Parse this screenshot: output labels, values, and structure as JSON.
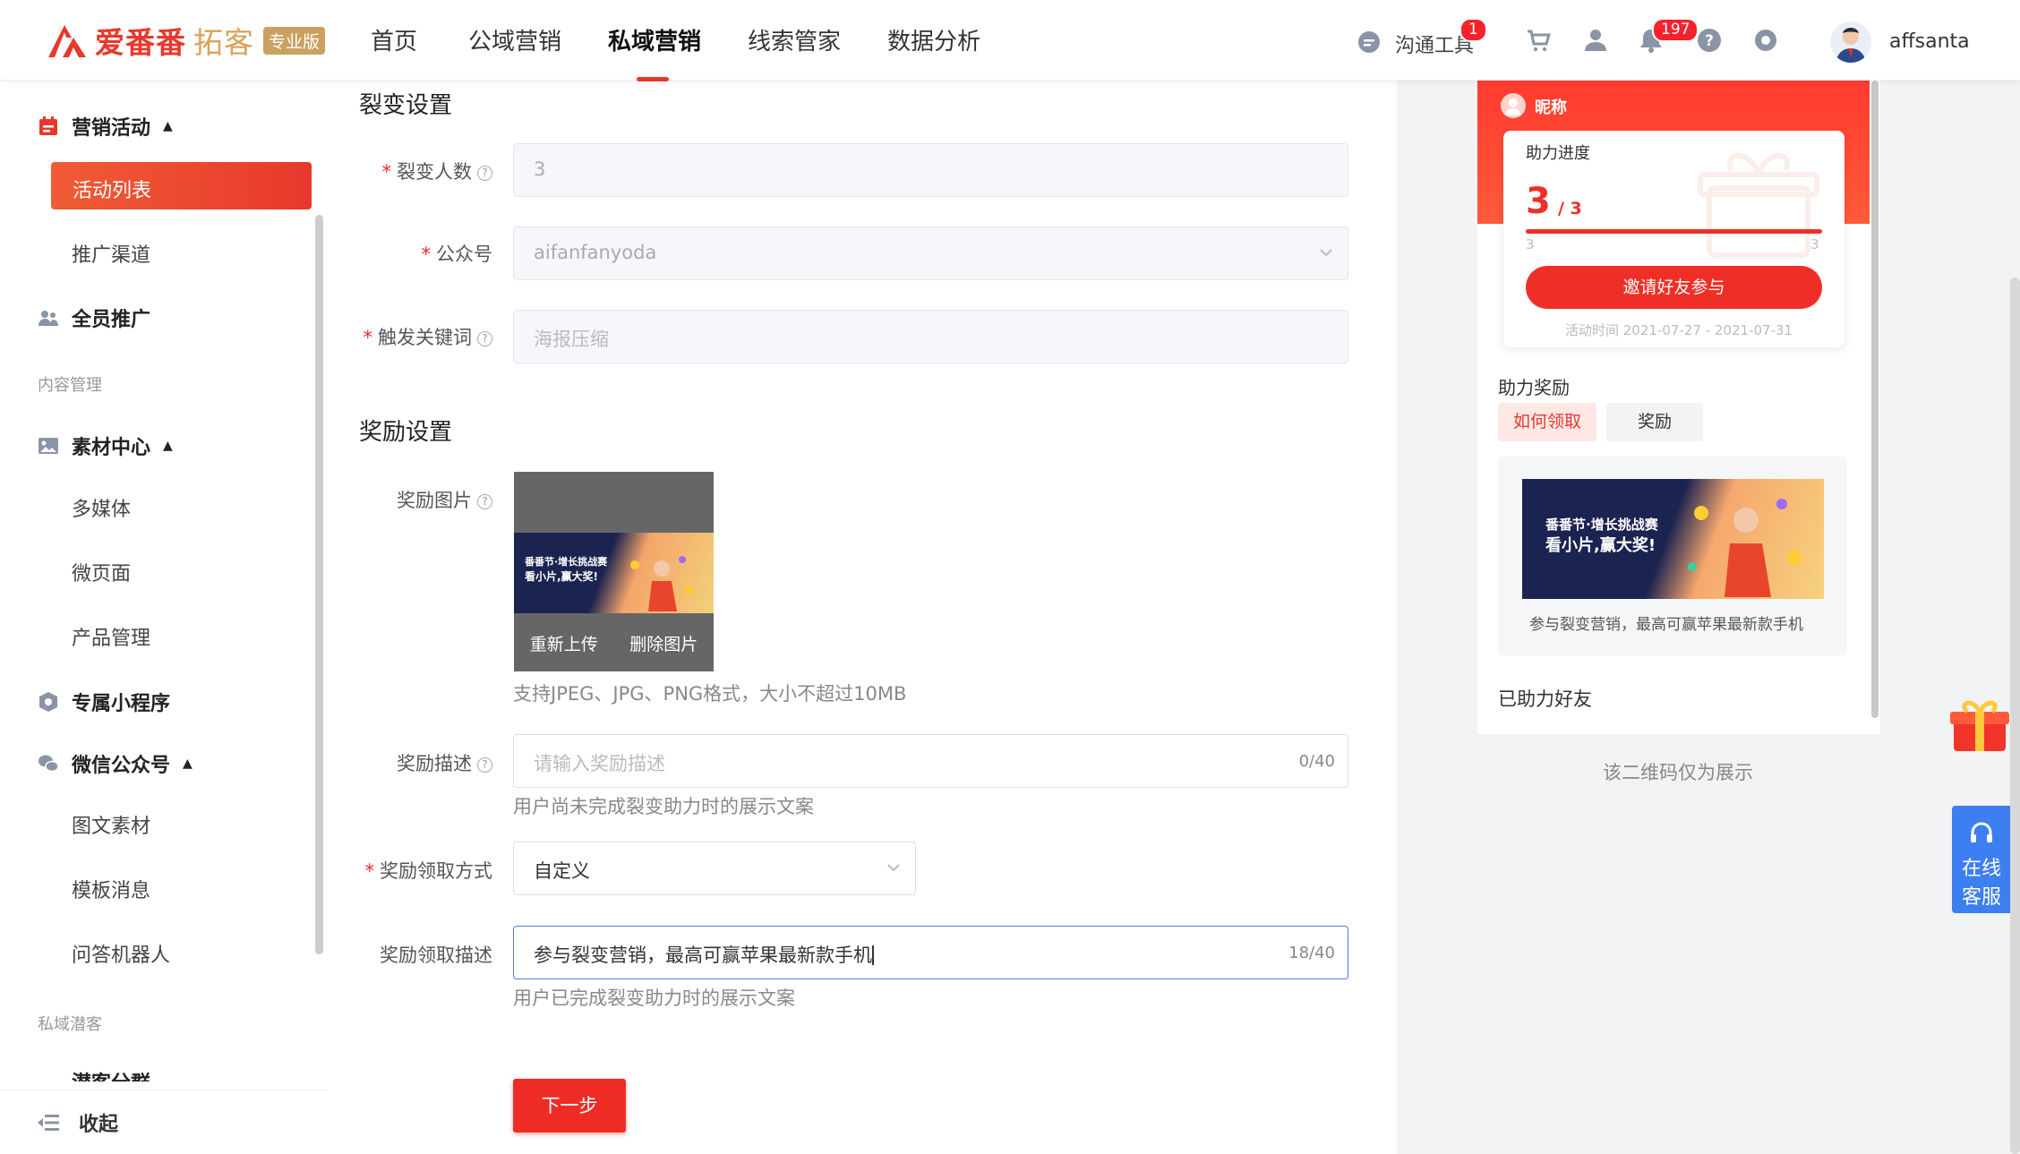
{
  "header": {
    "logo_title": "爱番番",
    "logo_sub": "拓客",
    "logo_badge": "专业版",
    "nav": [
      "首页",
      "公域营销",
      "私域营销",
      "线索管家",
      "数据分析"
    ],
    "active_nav": "私域营销",
    "tools_label": "沟通工具",
    "tools_badge": "1",
    "notify_badge": "197",
    "username": "affsanta"
  },
  "sidebar": {
    "group_marketing": "营销活动",
    "item_activity_list": "活动列表",
    "item_channel": "推广渠道",
    "group_all_staff": "全员推广",
    "label_content": "内容管理",
    "group_material": "素材中心",
    "item_multimedia": "多媒体",
    "item_micropage": "微页面",
    "item_product": "产品管理",
    "group_miniprogram": "专属小程序",
    "group_wechat": "微信公众号",
    "item_article": "图文素材",
    "item_template": "模板消息",
    "item_qa_robot": "问答机器人",
    "label_private": "私域潜客",
    "item_partial": "潜客分群",
    "collapse": "收起"
  },
  "form": {
    "section_fission": "裂变设置",
    "fission_count_label": "裂变人数",
    "fission_count_value": "3",
    "official_account_label": "公众号",
    "official_account_value": "aifanfanyoda",
    "keyword_label": "触发关键词",
    "keyword_placeholder": "海报压缩",
    "section_reward": "奖励设置",
    "reward_image_label": "奖励图片",
    "reupload": "重新上传",
    "delete_image": "删除图片",
    "image_hint": "支持JPEG、JPG、PNG格式，大小不超过10MB",
    "reward_desc_label": "奖励描述",
    "reward_desc_placeholder": "请输入奖励描述",
    "reward_desc_count": "0/40",
    "reward_desc_hint": "用户尚未完成裂变助力时的展示文案",
    "claim_method_label": "奖励领取方式",
    "claim_method_value": "自定义",
    "claim_desc_label": "奖励领取描述",
    "claim_desc_value": "参与裂变营销，最高可赢苹果最新款手机",
    "claim_desc_count": "18/40",
    "claim_desc_hint": "用户已完成裂变助力时的展示文案",
    "next_button": "下一步"
  },
  "preview": {
    "nickname": "昵称",
    "progress_title": "助力进度",
    "progress_current": "3",
    "progress_total": "/ 3",
    "progress_fraction": 1.0,
    "scale_min": "3",
    "scale_max": "3",
    "invite_button": "邀请好友参与",
    "activity_time": "活动时间 2021-07-27 - 2021-07-31",
    "reward_section": "助力奖励",
    "tab_how": "如何领取",
    "tab_reward": "奖励",
    "banner_line1": "番番节·增长挑战赛",
    "banner_line2": "看小片,赢大奖!",
    "reward_caption": "参与裂变营销，最高可赢苹果最新款手机",
    "helped_friends": "已助力好友",
    "qr_note": "该二维码仅为展示"
  },
  "floating": {
    "service_line1": "在线",
    "service_line2": "客服"
  },
  "colors": {
    "brand_red": "#e8382c",
    "gold": "#caa160",
    "service_blue": "#3d7ff0"
  }
}
